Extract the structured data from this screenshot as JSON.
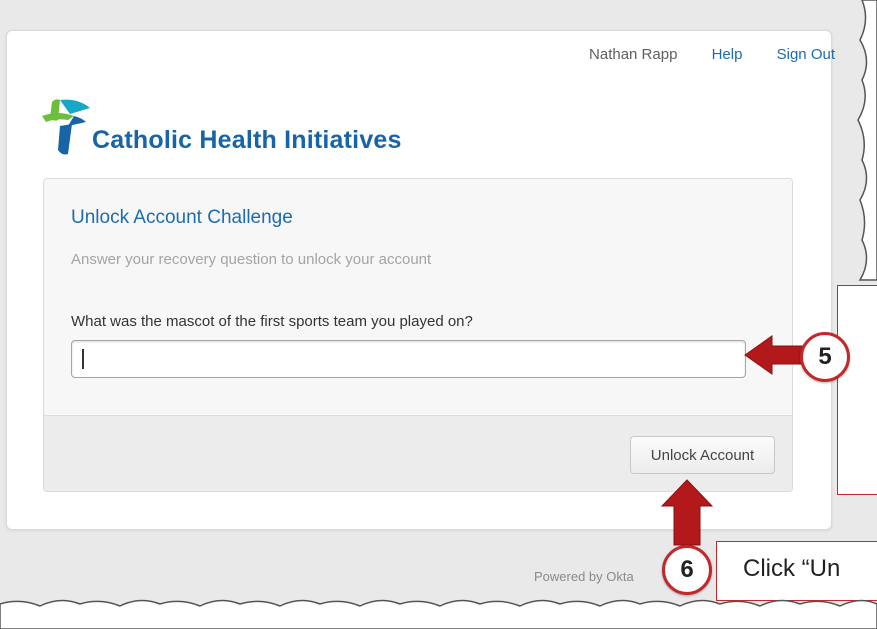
{
  "header": {
    "user_name": "Nathan Rapp",
    "help_label": "Help",
    "signout_label": "Sign Out"
  },
  "logo": {
    "name": "Catholic Health Initiatives",
    "colors": {
      "green": "#6bbf3b",
      "blue": "#1765a8",
      "teal": "#19a7c7"
    }
  },
  "challenge": {
    "title": "Unlock Account Challenge",
    "subtitle": "Answer your recovery question to unlock your account",
    "question": "What was the mascot of the first sports team you played on?",
    "answer_value": "",
    "button_label": "Unlock Account"
  },
  "footer": {
    "powered_by": "Powered by Okta"
  },
  "annotations": {
    "badge_5": "5",
    "badge_6": "6",
    "caption": "Click “Un",
    "accent_color": "#c0292b"
  }
}
